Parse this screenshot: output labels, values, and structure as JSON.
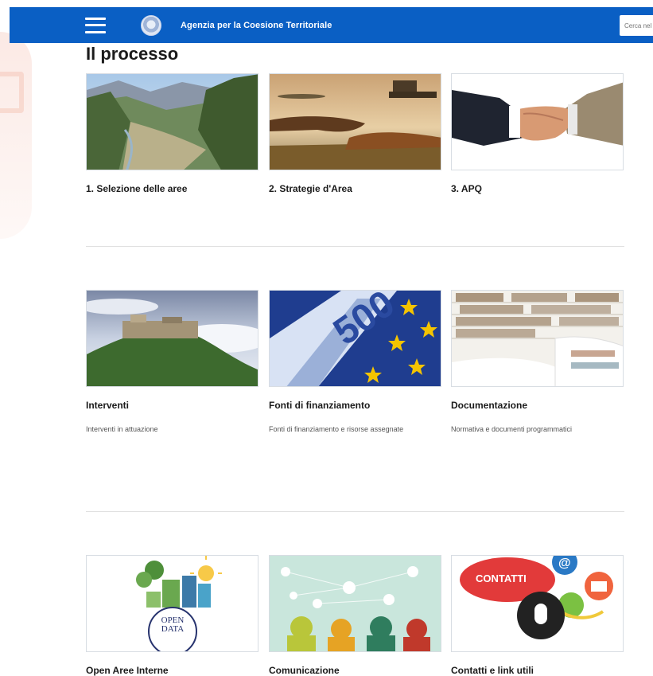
{
  "header": {
    "title": "Agenzia per la Coesione Territoriale",
    "search_placeholder": "Cerca nel sito"
  },
  "page": {
    "title": "Il processo"
  },
  "rows": [
    {
      "cards": [
        {
          "title": "1. Selezione delle aree",
          "description": "",
          "image": "mountain-valley-image"
        },
        {
          "title": "2. Strategie d'Area",
          "description": "",
          "image": "lake-sunset-image"
        },
        {
          "title": "3. APQ",
          "description": "",
          "image": "handshake-image"
        }
      ]
    },
    {
      "cards": [
        {
          "title": "Interventi",
          "description": "Interventi in attuazione",
          "image": "hilltop-village-image"
        },
        {
          "title": "Fonti di finanziamento",
          "description": "Fonti di finanziamento e risorse assegnate",
          "image": "euro-banknote-image"
        },
        {
          "title": "Documentazione",
          "description": "Normativa e documenti programmatici",
          "image": "library-image"
        }
      ]
    },
    {
      "cards": [
        {
          "title": "Open Aree Interne",
          "description": "",
          "image": "open-data-illustration",
          "image_text": "OPEN DATA"
        },
        {
          "title": "Comunicazione",
          "description": "",
          "image": "communication-illustration"
        },
        {
          "title": "Contatti e link utili",
          "description": "",
          "image": "contacts-illustration",
          "image_text": "CONTATTI"
        }
      ]
    }
  ]
}
